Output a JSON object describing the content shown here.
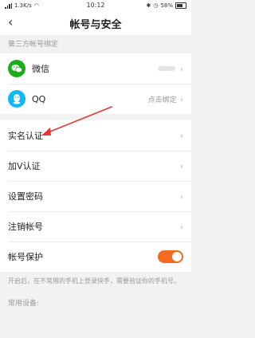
{
  "status_bar": {
    "speed": "1.3K/s",
    "time": "10:12",
    "battery": "58%"
  },
  "header": {
    "title": "帐号与安全",
    "back_icon": "chevron-left-icon"
  },
  "third_party": {
    "section_title": "第三方帐号绑定",
    "items": [
      {
        "label": "微信",
        "icon": "wechat-icon",
        "value": ""
      },
      {
        "label": "QQ",
        "icon": "qq-icon",
        "value": "点击绑定"
      }
    ]
  },
  "menu": {
    "items": [
      {
        "label": "实名认证"
      },
      {
        "label": "加V认证"
      },
      {
        "label": "设置密码"
      },
      {
        "label": "注销帐号"
      }
    ]
  },
  "account_protection": {
    "label": "帐号保护",
    "enabled": true,
    "hint": "开启后，在不常用的手机上登录快手，需要验证你的手机号。"
  },
  "common_devices": {
    "label": "常用设备:"
  },
  "colors": {
    "accent": "#f26b21",
    "wechat": "#1aad19",
    "qq": "#12b7f5",
    "annotation_arrow": "#e53935"
  }
}
